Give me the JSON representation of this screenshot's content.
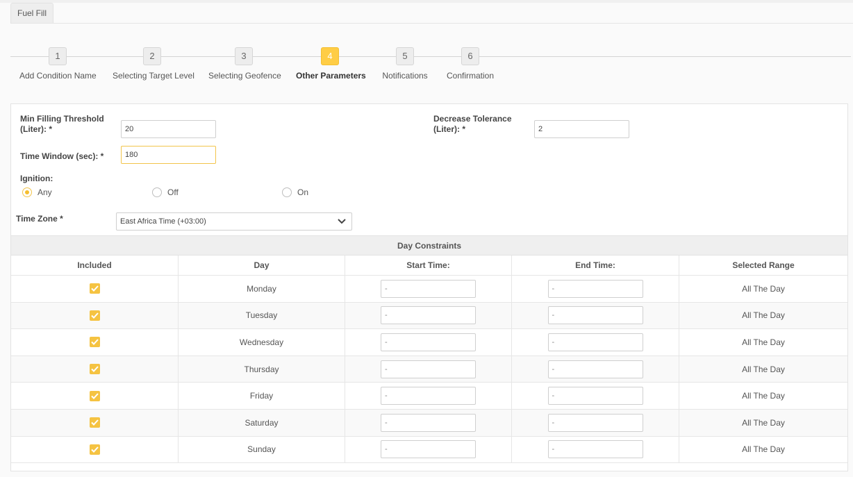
{
  "tab": {
    "label": "Fuel Fill"
  },
  "wizard": {
    "steps": [
      {
        "number": "1",
        "label": "Add Condition Name"
      },
      {
        "number": "2",
        "label": "Selecting Target Level"
      },
      {
        "number": "3",
        "label": "Selecting Geofence"
      },
      {
        "number": "4",
        "label": "Other Parameters"
      },
      {
        "number": "5",
        "label": "Notifications"
      },
      {
        "number": "6",
        "label": "Confirmation"
      }
    ],
    "active_step": 4
  },
  "form": {
    "min_filling_label_1": "Min Filling Threshold",
    "min_filling_label_2": "(Liter):  *",
    "min_filling_value": "20",
    "decrease_label_1": "Decrease Tolerance",
    "decrease_label_2": "(Liter):  *",
    "decrease_value": "2",
    "time_window_label": "Time Window (sec):  *",
    "time_window_value": "180",
    "ignition_label": "Ignition:",
    "ignition_options": [
      {
        "label": "Any",
        "checked": true
      },
      {
        "label": "Off",
        "checked": false
      },
      {
        "label": "On",
        "checked": false
      }
    ],
    "time_zone_label": "Time Zone  *",
    "time_zone_value": "East Africa Time (+03:00)"
  },
  "day_constraints": {
    "caption": "Day Constraints",
    "headers": [
      "Included",
      "Day",
      "Start Time:",
      "End Time:",
      "Selected Range"
    ],
    "rows": [
      {
        "day": "Monday",
        "start": "-",
        "end": "-",
        "range": "All The Day",
        "included": true
      },
      {
        "day": "Tuesday",
        "start": "-",
        "end": "-",
        "range": "All The Day",
        "included": true
      },
      {
        "day": "Wednesday",
        "start": "-",
        "end": "-",
        "range": "All The Day",
        "included": true
      },
      {
        "day": "Thursday",
        "start": "-",
        "end": "-",
        "range": "All The Day",
        "included": true
      },
      {
        "day": "Friday",
        "start": "-",
        "end": "-",
        "range": "All The Day",
        "included": true
      },
      {
        "day": "Saturday",
        "start": "-",
        "end": "-",
        "range": "All The Day",
        "included": true
      },
      {
        "day": "Sunday",
        "start": "-",
        "end": "-",
        "range": "All The Day",
        "included": true
      }
    ]
  },
  "colors": {
    "accent": "#ffcd45",
    "check": "#f5c342"
  },
  "icons": {
    "select_arrow": "chevron-down-icon",
    "checkbox": "check-icon"
  }
}
